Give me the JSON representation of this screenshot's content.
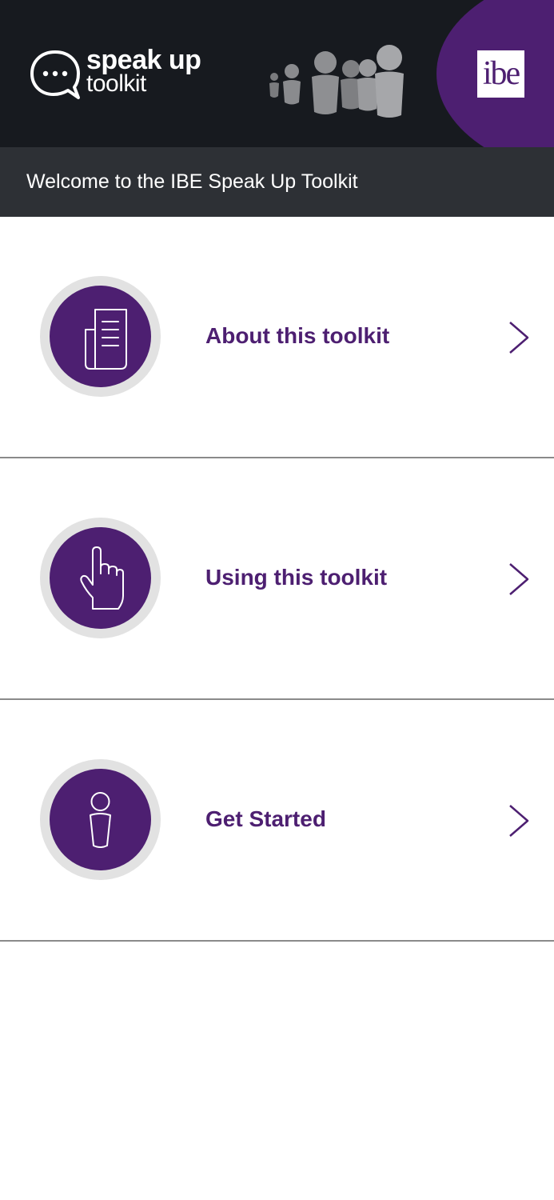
{
  "header": {
    "logo_line1": "speak up",
    "logo_line2": "toolkit",
    "brand_badge": "ibe",
    "accent_color": "#4d1f71",
    "background_color": "#171a1f"
  },
  "welcome": {
    "text": "Welcome to the IBE Speak Up Toolkit"
  },
  "menu": {
    "items": [
      {
        "label": "About this toolkit",
        "icon": "document-icon"
      },
      {
        "label": "Using this toolkit",
        "icon": "pointing-hand-icon"
      },
      {
        "label": "Get Started",
        "icon": "person-icon"
      }
    ]
  }
}
